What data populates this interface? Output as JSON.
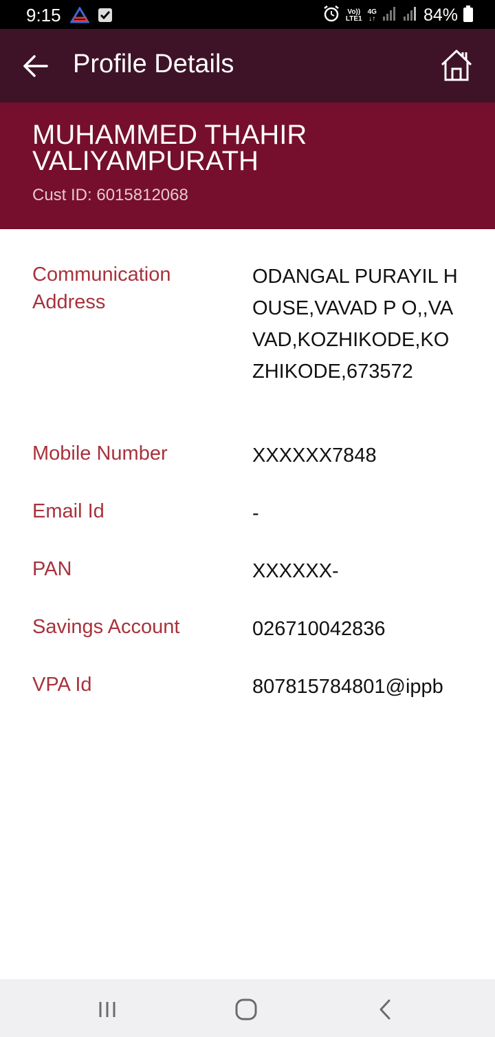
{
  "status_bar": {
    "time": "9:15",
    "left_icons": [
      "carrier-logo-icon",
      "checkbox-notification-icon"
    ],
    "volte": "Vo))",
    "lte": "LTE1",
    "network": "4G",
    "battery_percent": "84%"
  },
  "app_bar": {
    "title": "Profile Details",
    "back_icon": "arrow-left-icon",
    "home_icon": "home-icon"
  },
  "profile": {
    "name": "MUHAMMED THAHIR VALIYAMPURATH",
    "cust_id": "Cust ID: 6015812068"
  },
  "details": {
    "address_label": "Communication Address",
    "address_value": "ODANGAL PURAYIL HOUSE,VAVAD P O,,VAVAD,KOZHIKODE,KOZHIKODE,673572",
    "mobile_label": "Mobile Number",
    "mobile_value": "XXXXXX7848",
    "email_label": "Email Id",
    "email_value": "-",
    "pan_label": "PAN",
    "pan_value": "XXXXXX-",
    "savings_label": "Savings Account",
    "savings_value": "026710042836",
    "vpa_label": "VPA Id",
    "vpa_value": "807815784801@ippb"
  },
  "colors": {
    "app_bar": "#3f1327",
    "header": "#760f2d",
    "label": "#a8323c",
    "value": "#111111"
  },
  "nav_bar": {
    "icons": [
      "recent-apps-icon",
      "home-circle-icon",
      "back-chevron-icon"
    ]
  }
}
